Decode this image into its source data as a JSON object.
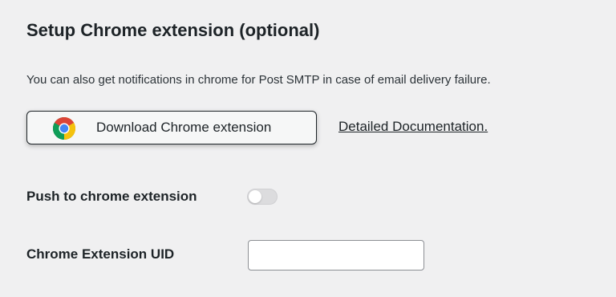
{
  "section": {
    "title": "Setup Chrome extension (optional)",
    "description": "You can also get notifications in chrome for Post SMTP in case of email delivery failure."
  },
  "download_button": {
    "label": "Download Chrome extension",
    "icon": "chrome-logo-icon"
  },
  "documentation_link": {
    "label": "Detailed Documentation."
  },
  "push_setting": {
    "label": "Push to chrome extension",
    "enabled": false
  },
  "uid_field": {
    "label": "Chrome Extension UID",
    "value": "",
    "placeholder": ""
  },
  "colors": {
    "background": "#f0f0f1",
    "text": "#1d2327",
    "toggle_off": "#dcdcde",
    "chrome_red": "#db4437",
    "chrome_yellow": "#f4c20d",
    "chrome_green": "#0f9d58",
    "chrome_blue": "#4285f4"
  }
}
